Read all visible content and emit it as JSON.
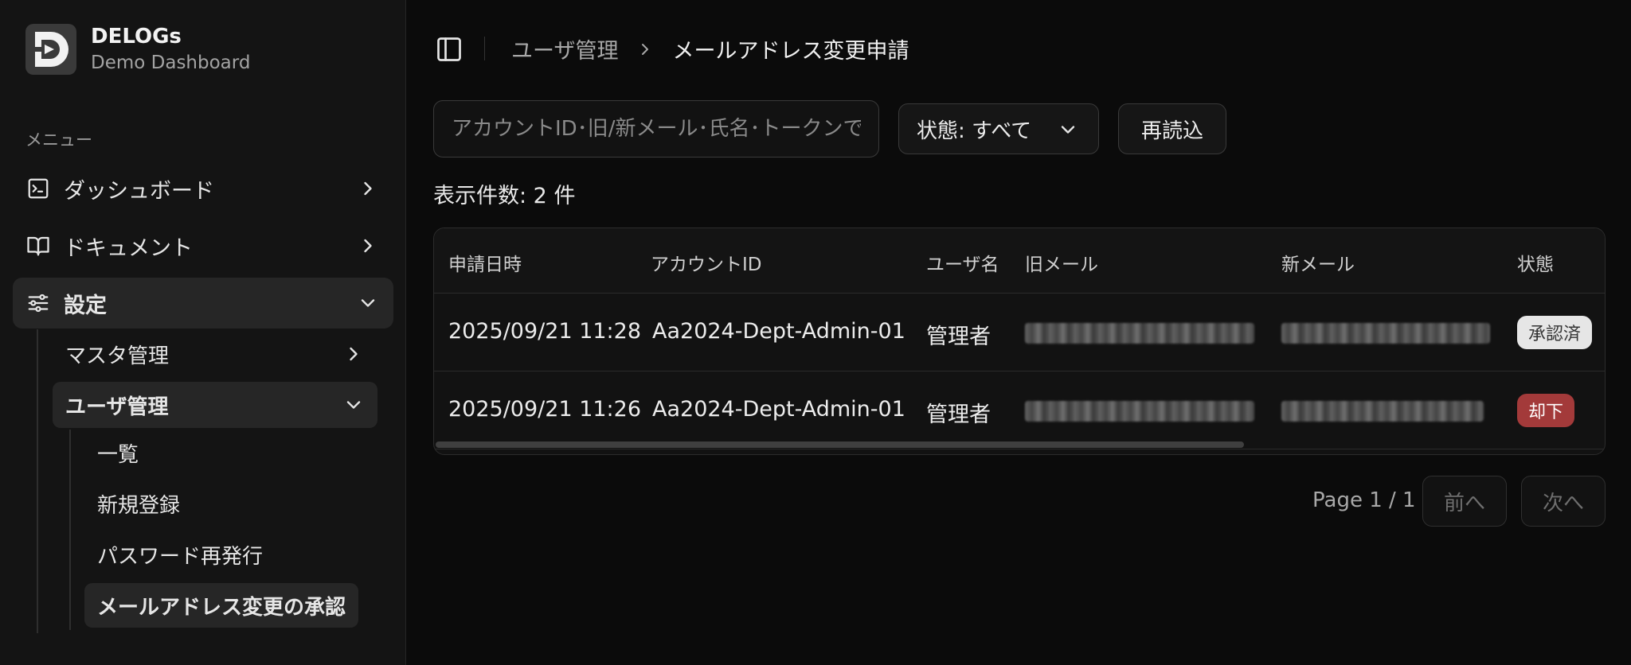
{
  "brand": {
    "name": "DELOGs",
    "subtitle": "Demo Dashboard"
  },
  "sidebar": {
    "menu_label": "メニュー",
    "items": [
      {
        "label": "ダッシュボード",
        "icon": "terminal-square-icon"
      },
      {
        "label": "ドキュメント",
        "icon": "book-open-icon"
      },
      {
        "label": "設定",
        "icon": "settings-sliders-icon",
        "expanded": true
      }
    ],
    "sub_items": [
      {
        "label": "マスタ管理"
      },
      {
        "label": "ユーザ管理",
        "expanded": true
      }
    ],
    "leaf_items": [
      {
        "label": "一覧"
      },
      {
        "label": "新規登録"
      },
      {
        "label": "パスワード再発行"
      },
      {
        "label": "メールアドレス変更の承認",
        "active": true
      }
    ]
  },
  "header": {
    "breadcrumb_parent": "ユーザ管理",
    "breadcrumb_current": "メールアドレス変更申請"
  },
  "toolbar": {
    "search_placeholder": "アカウントID･旧/新メール･氏名･トークンで",
    "status_select_label": "状態: すべて",
    "reload_label": "再読込"
  },
  "summary": {
    "count_label": "表示件数: 2 件"
  },
  "table": {
    "columns": [
      "申請日時",
      "アカウントID",
      "ユーザ名",
      "旧メール",
      "新メール",
      "状態"
    ],
    "rows": [
      {
        "requested_at": "2025/09/21 11:28",
        "account_id": "Aa2024-Dept-Admin-01",
        "user_name": "管理者",
        "status": "承認済",
        "status_kind": "approved"
      },
      {
        "requested_at": "2025/09/21 11:26",
        "account_id": "Aa2024-Dept-Admin-01",
        "user_name": "管理者",
        "status": "却下",
        "status_kind": "rejected"
      }
    ]
  },
  "pagination": {
    "page_info": "Page 1 / 1",
    "prev_label": "前へ",
    "next_label": "次へ"
  },
  "colors": {
    "background": "#0b0b0b",
    "sidebar": "#141414",
    "approved_badge": "#e6e6e6",
    "rejected_badge": "#a33a3a"
  }
}
